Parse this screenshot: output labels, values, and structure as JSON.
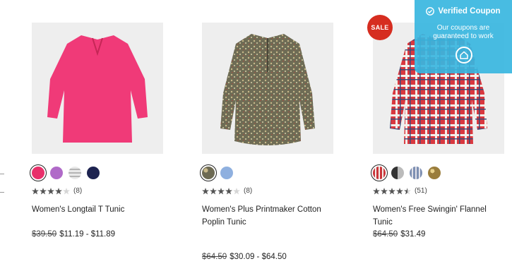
{
  "products": [
    {
      "name": "Women's Longtail T Tunic",
      "rating_value": 4,
      "review_count": "(8)",
      "price_original": "$39.50",
      "price_current": "$11.19 - $11.89",
      "swatches": [
        "#e8306a",
        "#b06ac8",
        "#d9d9d9",
        "#1d2350"
      ],
      "image_icon": "pink-tunic"
    },
    {
      "name": "Women's Plus Printmaker Cotton Poplin Tunic",
      "rating_value": 4,
      "review_count": "(8)",
      "price_original": "$64.50",
      "price_current": "$30.09 - $64.50",
      "swatches": [
        "#6d6a53",
        "#8fb0df"
      ],
      "image_icon": "floral-tunic"
    },
    {
      "name": "Women's Free Swingin' Flannel Tunic",
      "rating_value": 4.5,
      "review_count": "(51)",
      "price_original": "$64.50",
      "price_current": "$31.49",
      "swatches": [
        "#c9353a",
        "#555555",
        "#7d8fb2",
        "#c0a35a"
      ],
      "image_icon": "plaid-tunic",
      "badge": "SALE"
    }
  ],
  "coupon": {
    "title": "Verified Coupon",
    "subtitle": "Our coupons are guaranteed to work"
  },
  "colors": {
    "accent": "#38b6e0",
    "sale": "#d62d20"
  }
}
